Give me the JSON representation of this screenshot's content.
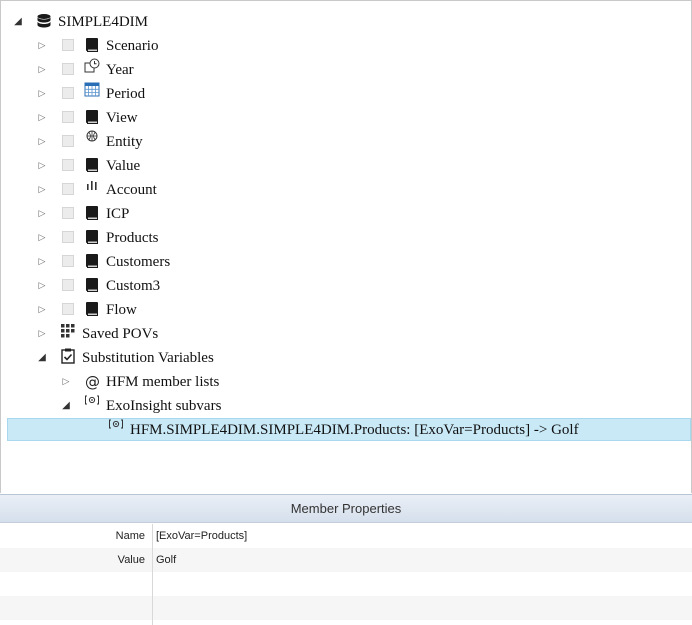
{
  "tree": {
    "root": {
      "label": "SIMPLE4DIM",
      "icon": "database-icon"
    },
    "dimensions": [
      {
        "label": "Scenario",
        "icon": "book-icon"
      },
      {
        "label": "Year",
        "icon": "clock-icon"
      },
      {
        "label": "Period",
        "icon": "calendar-icon"
      },
      {
        "label": "View",
        "icon": "book-icon"
      },
      {
        "label": "Entity",
        "icon": "globe-icon"
      },
      {
        "label": "Value",
        "icon": "book-icon"
      },
      {
        "label": "Account",
        "icon": "bar-chart-icon"
      },
      {
        "label": "ICP",
        "icon": "book-icon"
      },
      {
        "label": "Products",
        "icon": "book-icon"
      },
      {
        "label": "Customers",
        "icon": "book-icon"
      },
      {
        "label": "Custom3",
        "icon": "book-icon"
      },
      {
        "label": "Flow",
        "icon": "book-icon"
      }
    ],
    "saved_povs": {
      "label": "Saved POVs",
      "icon": "grid-icon"
    },
    "substitution_variables": {
      "label": "Substitution Variables",
      "icon": "clipboard-check-icon",
      "children": [
        {
          "label": "HFM member lists",
          "icon": "at-icon"
        },
        {
          "label": "ExoInsight subvars",
          "icon": "subvar-icon"
        }
      ],
      "selected_item": {
        "label": "HFM.SIMPLE4DIM.SIMPLE4DIM.Products: [ExoVar=Products] -> Golf",
        "icon": "subvar-icon"
      }
    }
  },
  "member_properties": {
    "title": "Member Properties",
    "rows": [
      {
        "name": "Name",
        "value": "[ExoVar=Products]"
      },
      {
        "name": "Value",
        "value": "Golf"
      }
    ]
  }
}
